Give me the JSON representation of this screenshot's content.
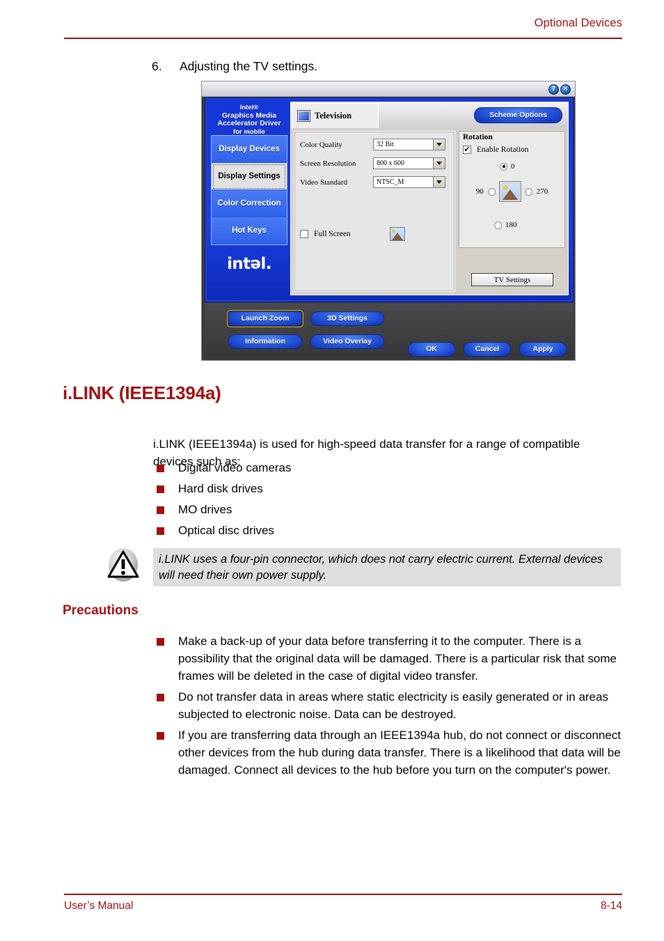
{
  "page": {
    "header_title": "Optional Devices",
    "footer_left": "User’s Manual",
    "footer_right": "8-14",
    "accent_color": "#a31010"
  },
  "step": {
    "number": "6.",
    "text": "Adjusting the TV settings."
  },
  "dialog": {
    "titlebar": {
      "help_label": "?",
      "close_label": "✕"
    },
    "brand": {
      "line1": "Intel®",
      "line2": "Graphics Media",
      "line3": "Accelerator Driver",
      "line4": "for mobile",
      "logo": "intel."
    },
    "nav_items": [
      {
        "label": "Display Devices",
        "selected": false
      },
      {
        "label": "Display Settings",
        "selected": true
      },
      {
        "label": "Color Correction",
        "selected": false
      },
      {
        "label": "Hot Keys",
        "selected": false
      }
    ],
    "tab": {
      "label": "Television"
    },
    "scheme_options_label": "Scheme Options",
    "fields": [
      {
        "label": "Color Quality",
        "value": "32 Bit"
      },
      {
        "label": "Screen Resolution",
        "value": "800 x 600"
      },
      {
        "label": "Video Standard",
        "value": "NTSC_M"
      }
    ],
    "full_screen": {
      "label": "Full Screen",
      "checked": false,
      "check_glyph": ""
    },
    "rotation": {
      "group_title": "Rotation",
      "enable_label": "Enable Rotation",
      "enable_checked": true,
      "check_glyph": "✔",
      "options": [
        {
          "label": "0",
          "selected": true
        },
        {
          "label": "90",
          "selected": false
        },
        {
          "label": "270",
          "selected": false
        },
        {
          "label": "180",
          "selected": false
        }
      ]
    },
    "tv_settings_label": "TV Settings",
    "action_buttons": [
      {
        "label": "Launch Zoom",
        "focused": true
      },
      {
        "label": "3D Settings",
        "focused": false
      },
      {
        "label": "Information",
        "focused": false
      },
      {
        "label": "Video Overlay",
        "focused": false
      },
      {
        "label": "OK",
        "focused": false
      },
      {
        "label": "Cancel",
        "focused": false
      },
      {
        "label": "Apply",
        "focused": false
      }
    ]
  },
  "section": {
    "title": "i.LINK (IEEE1394a)",
    "intro": "i.LINK (IEEE1394a) is used for high-speed data transfer for a range of compatible devices such as:",
    "devices": [
      "Digital video cameras",
      "Hard disk drives",
      "MO drives",
      "Optical disc drives"
    ],
    "note": "i.LINK uses a four-pin connector, which does not carry electric current. External devices will need their own power supply.",
    "precautions_title": "Precautions",
    "precautions": [
      "Make a back-up of your data before transferring it to the computer. There is a possibility that the original data will be damaged. There is a particular risk that some frames will be deleted in the case of digital video transfer.",
      "Do not transfer data in areas where static electricity is easily generated or in areas subjected to electronic noise. Data can be destroyed.",
      "If you are transferring data through an IEEE1394a hub, do not connect or disconnect other devices from the hub during data transfer. There is a likelihood that data will be damaged. Connect all devices to the hub before you turn on the computer's power."
    ]
  }
}
